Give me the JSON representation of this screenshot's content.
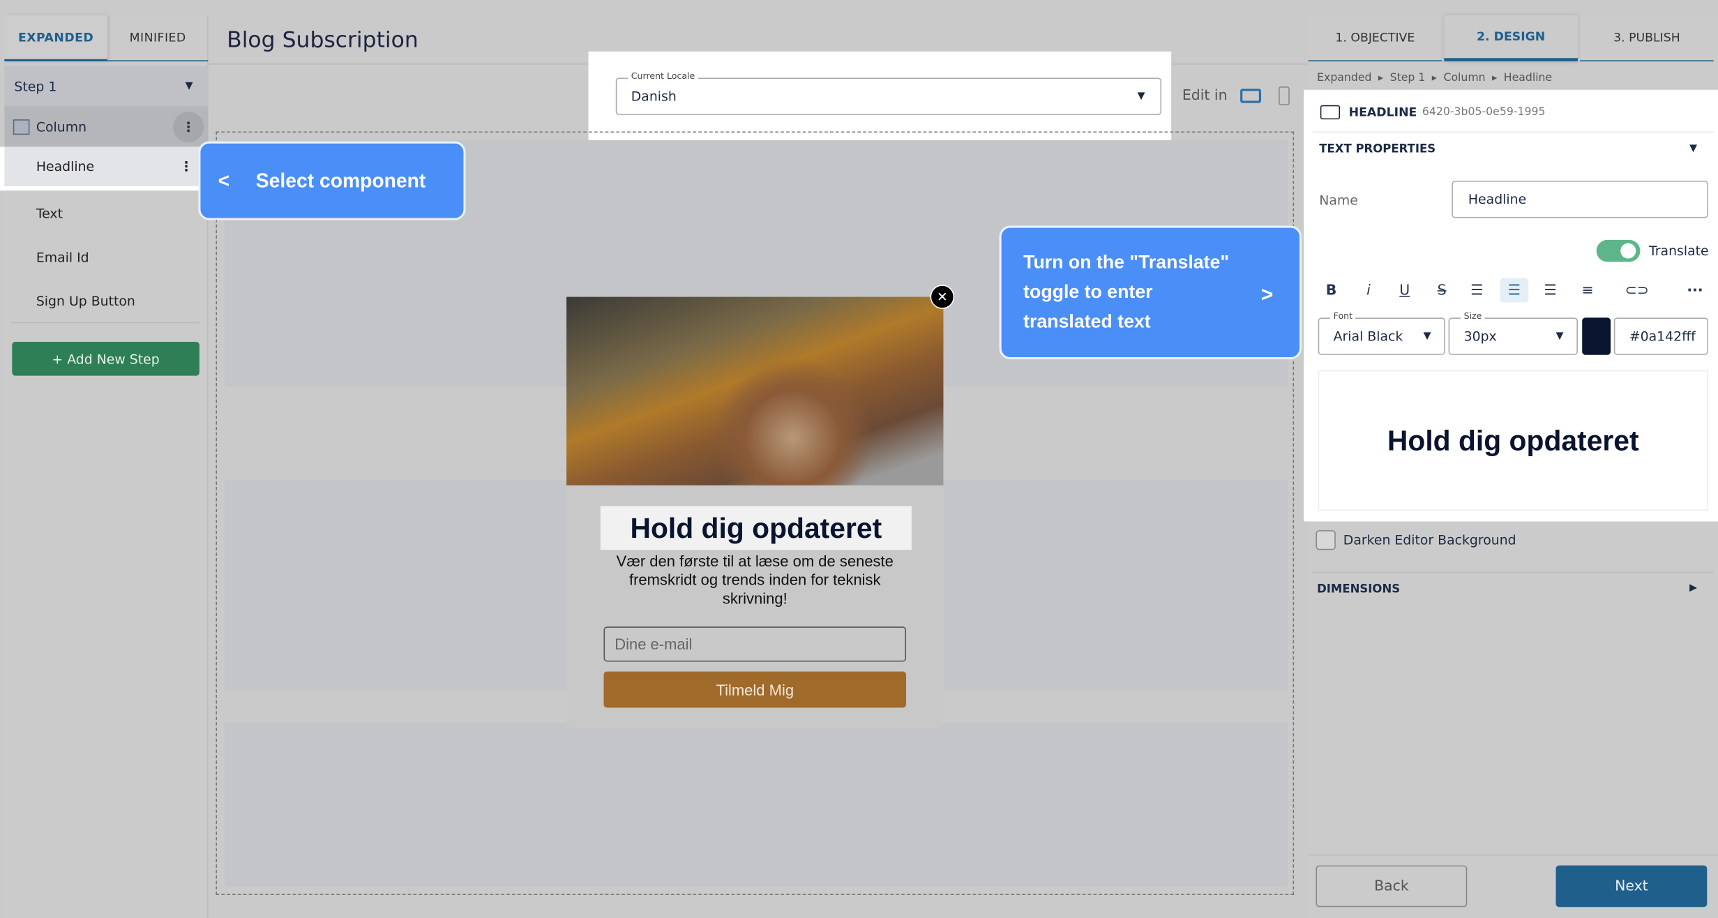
{
  "left_panel": {
    "tabs": [
      {
        "label": "EXPANDED",
        "active": true
      },
      {
        "label": "MINIFIED",
        "active": false
      }
    ],
    "step": "Step 1",
    "column": "Column",
    "items": [
      "Headline",
      "Text",
      "Email Id",
      "Sign Up Button"
    ],
    "add_step": "+ Add New Step"
  },
  "header": {
    "title": "Blog Subscription",
    "locale_label": "Current Locale",
    "locale_value": "Danish",
    "edit_in": "Edit in"
  },
  "callouts": {
    "select": "Select component",
    "select_arrow": "<",
    "translate": "Turn on the \"Translate\" toggle to enter translated text",
    "translate_arrow": ">"
  },
  "popup": {
    "headline": "Hold dig opdateret",
    "body": "Vær den første til at læse om de seneste fremskridt og trends inden for teknisk skrivning!",
    "email_placeholder": "Dine e-mail",
    "button": "Tilmeld Mig",
    "button_color": "#a06a2a"
  },
  "right_panel": {
    "tabs": [
      {
        "label": "1. OBJECTIVE"
      },
      {
        "label": "2. DESIGN",
        "active": true
      },
      {
        "label": "3. PUBLISH"
      }
    ],
    "breadcrumb": [
      "Expanded",
      "Step 1",
      "Column",
      "Headline"
    ],
    "component_type": "HEADLINE",
    "component_id": "6420-3b05-0e59-1995",
    "section": "TEXT PROPERTIES",
    "name_label": "Name",
    "name_value": "Headline",
    "translate_label": "Translate",
    "translate_on": true,
    "font_label": "Font",
    "font_value": "Arial Black",
    "size_label": "Size",
    "size_value": "30px",
    "color_value": "#0a142fff",
    "preview": "Hold dig opdateret",
    "darken_label": "Darken Editor Background",
    "dimensions": "DIMENSIONS",
    "back": "Back",
    "next": "Next",
    "accent": "#1f5f8b",
    "toggle_color": "#5fb58a"
  }
}
